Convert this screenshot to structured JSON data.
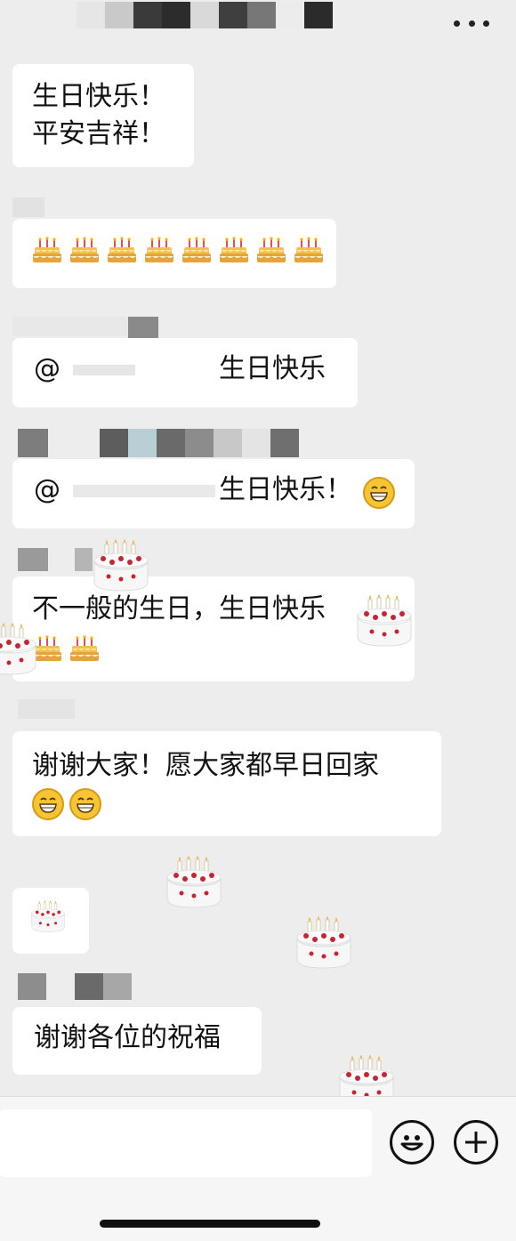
{
  "header": {
    "menu_icon": "more-dots-icon"
  },
  "messages": [
    {
      "text_line1": "生日快乐！",
      "text_line2": "平安吉祥！"
    },
    {
      "cakes": 8
    },
    {
      "mention": "@",
      "text": "生日快乐"
    },
    {
      "mention": "@",
      "text": "生日快乐！"
    },
    {
      "text": "不一般的生日，生日快乐"
    },
    {
      "text": "谢谢大家！愿大家都早日回家"
    },
    {
      "sticker": "cake-sticker"
    },
    {
      "text": "谢谢各位的祝福"
    }
  ],
  "input_bar": {
    "emoji_button_icon": "smiley-icon",
    "plus_button_icon": "plus-icon"
  }
}
